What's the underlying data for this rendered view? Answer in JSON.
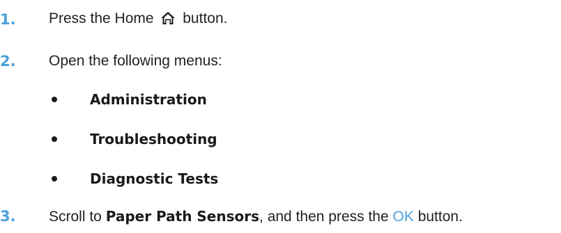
{
  "steps": [
    {
      "number": "1.",
      "before": "Press the Home",
      "icon": "home-icon",
      "after": "button."
    },
    {
      "number": "2.",
      "text": "Open the following menus:"
    },
    {
      "number": "3.",
      "before": "Scroll to",
      "bold": "Paper Path Sensors",
      "middle": ", and then press the",
      "ok": "OK",
      "after": "button."
    }
  ],
  "menus": [
    "Administration",
    "Troubleshooting",
    "Diagnostic Tests"
  ],
  "colors": {
    "accent": "#4aa0db",
    "text": "#222222"
  }
}
